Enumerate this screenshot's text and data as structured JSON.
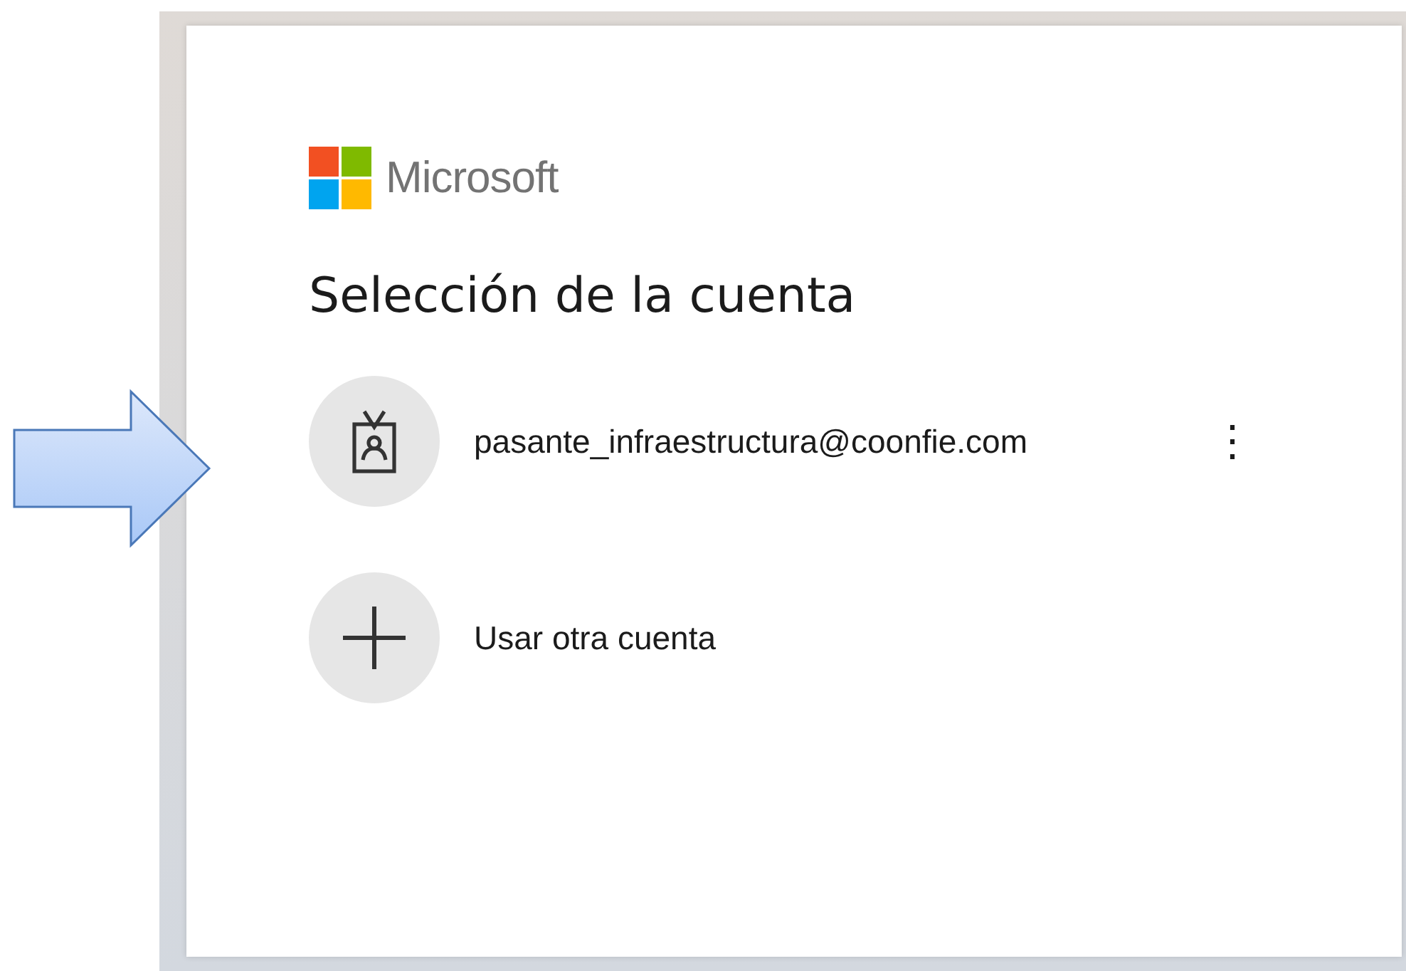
{
  "brand": {
    "name": "Microsoft"
  },
  "title": "Selección de la cuenta",
  "accounts": [
    {
      "kind": "account",
      "label": "pasante_infraestructura@coonfie.com",
      "menu": "⋮"
    },
    {
      "kind": "add",
      "label": "Usar otra cuenta"
    }
  ]
}
